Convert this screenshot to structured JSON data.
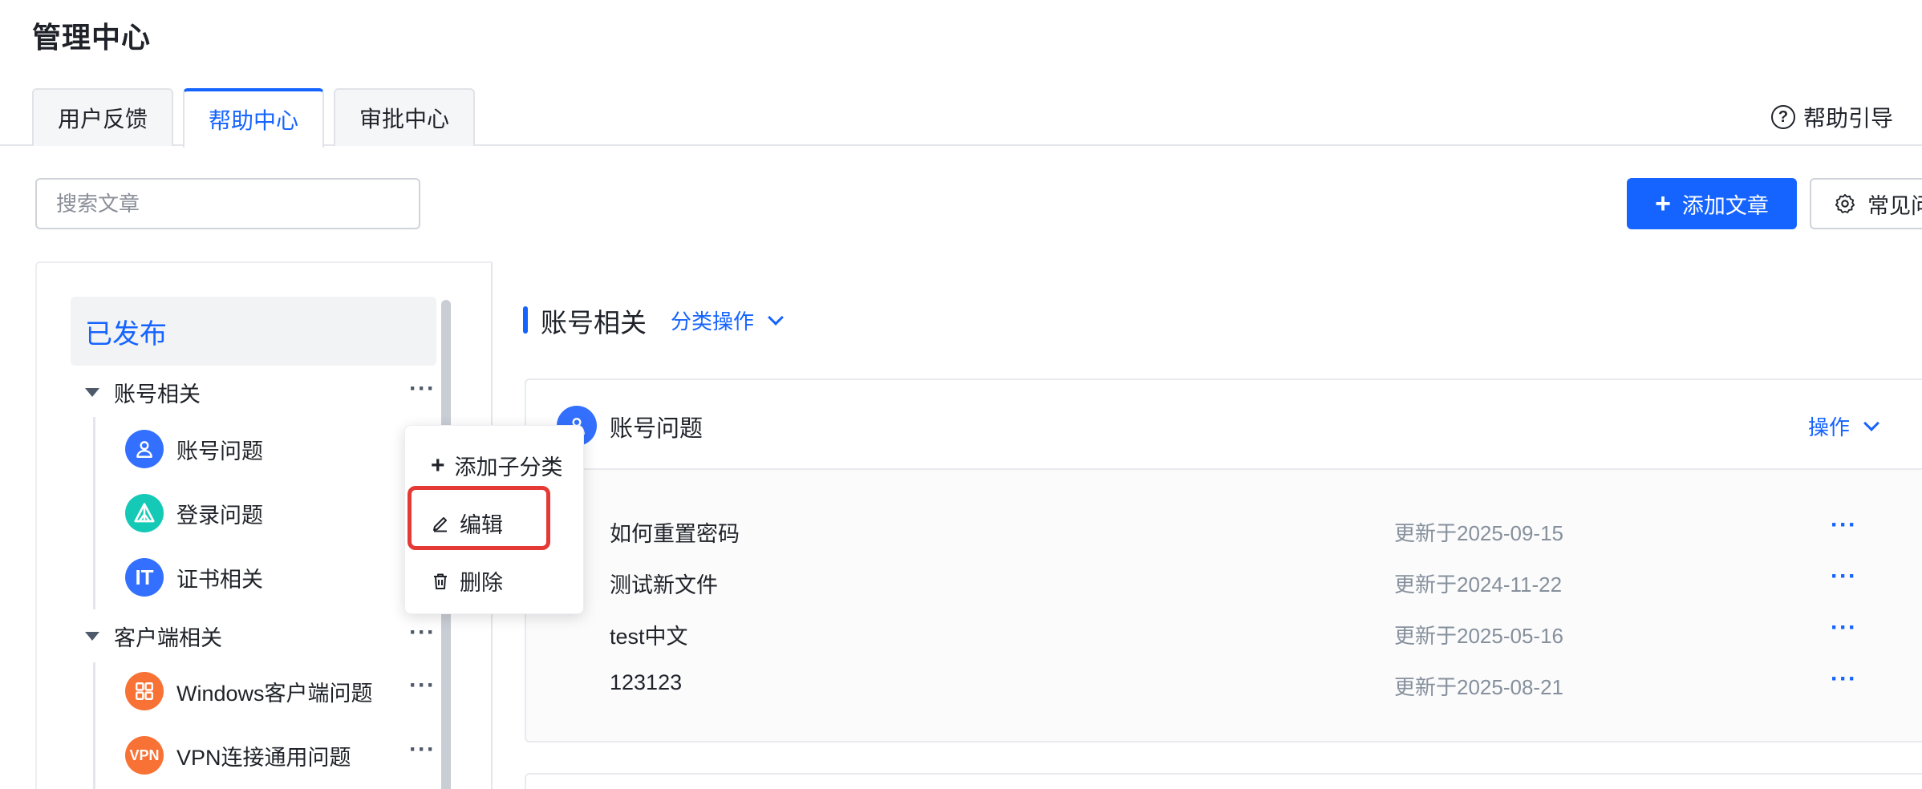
{
  "page": {
    "title": "管理中心"
  },
  "tabs": [
    {
      "label": "用户反馈",
      "active": false
    },
    {
      "label": "帮助中心",
      "active": true
    },
    {
      "label": "审批中心",
      "active": false
    }
  ],
  "header": {
    "help_guide_label": "帮助引导"
  },
  "toolbar": {
    "search_placeholder": "搜索文章",
    "add_article_label": "添加文章",
    "faq_label": "常见问"
  },
  "sidebar": {
    "section_label": "已发布",
    "groups": [
      {
        "label": "账号相关",
        "children": [
          {
            "label": "账号问题",
            "icon": "user-icon",
            "color": "#3370ff"
          },
          {
            "label": "登录问题",
            "icon": "triangle-logo-icon",
            "color": "#14c9b5"
          },
          {
            "label": "证书相关",
            "icon": "it-icon",
            "icon_text": "IT",
            "color": "#3370ff"
          }
        ]
      },
      {
        "label": "客户端相关",
        "children": [
          {
            "label": "Windows客户端问题",
            "icon": "grid-icon",
            "color": "#f77234"
          },
          {
            "label": "VPN连接通用问题",
            "icon": "vpn-icon",
            "icon_text": "VPN",
            "color": "#f77234"
          }
        ]
      }
    ]
  },
  "context_menu": {
    "items": [
      {
        "label": "添加子分类",
        "icon": "plus-icon"
      },
      {
        "label": "编辑",
        "icon": "edit-icon"
      },
      {
        "label": "删除",
        "icon": "trash-icon"
      }
    ]
  },
  "main": {
    "category_title": "账号相关",
    "category_action_label": "分类操作",
    "card": {
      "title": "账号问题",
      "action_label": "操作",
      "articles": [
        {
          "title": "如何重置密码",
          "updated": "更新于2025-09-15"
        },
        {
          "title": "测试新文件",
          "updated": "更新于2024-11-22"
        },
        {
          "title": "test中文",
          "updated": "更新于2025-05-16"
        },
        {
          "title": "123123",
          "updated": "更新于2025-08-21"
        }
      ]
    }
  },
  "colors": {
    "accent": "#1664ff",
    "highlight": "#e53935"
  }
}
